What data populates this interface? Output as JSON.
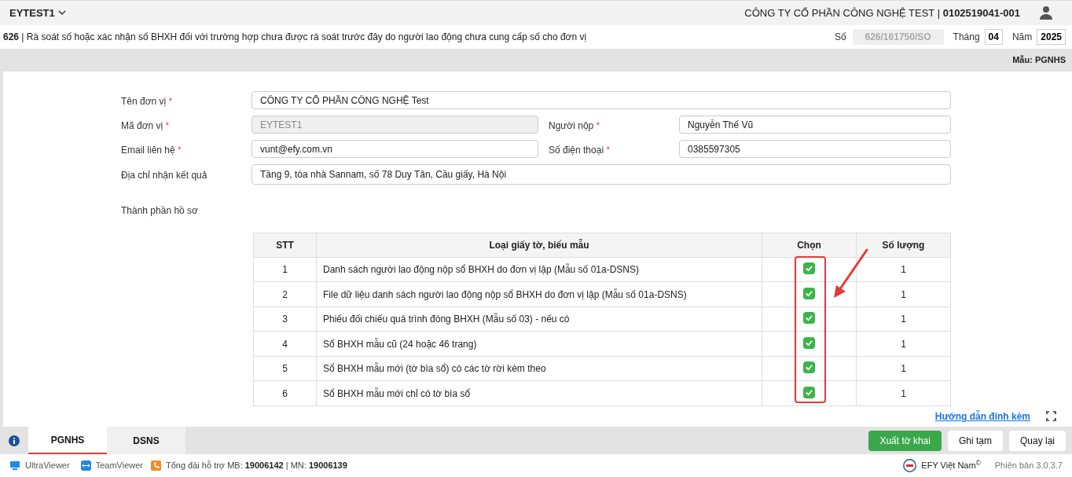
{
  "top_bar": {
    "unit_code": "EYTEST1",
    "company": "CÔNG TY CỔ PHẦN CÔNG NGHỆ TEST | ",
    "tax_code": "0102519041-001"
  },
  "title_bar": {
    "code": "626",
    "title": " | Rà soát số hoặc xác nhận số BHXH đối với trường hợp chưa được rà soát trước đây do người lao động chưa cung cấp số cho đơn vị",
    "number_label": "Số",
    "number_value": "626/161750/SO",
    "month_label": "Tháng",
    "month_value": "04",
    "year_label": "Năm",
    "year_value": "2025"
  },
  "template_label": "Mẫu: PGNHS",
  "form": {
    "unit_name": {
      "label": "Tên đơn vị",
      "value": "CÔNG TY CỔ PHẦN CÔNG NGHỆ Test"
    },
    "unit_code": {
      "label": "Mã đơn vị",
      "value": "EYTEST1",
      "disabled": true
    },
    "submitter": {
      "label": "Người nộp",
      "value": "Nguyễn Thế Vũ"
    },
    "email": {
      "label": "Email liên hệ",
      "value": "vunt@efy.com.vn"
    },
    "phone": {
      "label": "Số điện thoại",
      "value": "0385597305"
    },
    "address": {
      "label": "Địa chỉ nhận kết quả",
      "value": "Tầng 9, tòa nhà Sannam, số 78 Duy Tân, Cầu giấy, Hà Nội"
    },
    "required_mark": "*"
  },
  "section_label": "Thành phần hồ sơ",
  "table": {
    "columns": [
      "STT",
      "Loại giấy tờ, biểu mẫu",
      "Chọn",
      "Số lượng"
    ],
    "rows": [
      {
        "stt": "1",
        "name": "Danh sách người lao động nộp sổ BHXH do đơn vị lập (Mẫu số 01a-DSNS)",
        "checked": true,
        "quantity": "1"
      },
      {
        "stt": "2",
        "name": "File dữ liệu danh sách người lao động nộp sổ BHXH do đơn vị lập (Mẫu số 01a-DSNS)",
        "checked": true,
        "quantity": "1"
      },
      {
        "stt": "3",
        "name": "Phiếu đối chiếu quá trình đóng BHXH (Mẫu số 03) - nếu có",
        "checked": true,
        "quantity": "1"
      },
      {
        "stt": "4",
        "name": "Sổ BHXH mẫu cũ (24 hoặc 46 trang)",
        "checked": true,
        "quantity": "1"
      },
      {
        "stt": "5",
        "name": "Sổ BHXH mẫu mới (tờ bìa sổ) có các tờ rời kèm theo",
        "checked": true,
        "quantity": "1"
      },
      {
        "stt": "6",
        "name": "Sổ BHXH mẫu mới chỉ có tờ bìa sổ",
        "checked": true,
        "quantity": "1"
      }
    ]
  },
  "guide_link": "Hướng dẫn đính kèm",
  "tabs": [
    {
      "label": "PGNHS",
      "selected": true
    },
    {
      "label": "DSNS",
      "selected": false
    }
  ],
  "buttons": [
    {
      "label": "Xuất tờ khai",
      "kind": "primary"
    },
    {
      "label": "Ghi tạm",
      "kind": "secondary"
    },
    {
      "label": "Quay lại",
      "kind": "secondary"
    }
  ],
  "footer": {
    "ultraviewer": "UltraViewer",
    "teamviewer": "TeamViewer",
    "hotline_prefix": "Tổng đài hỗ trợ MB: ",
    "hotline_mb": "19006142",
    "hotline_sep": " | MN: ",
    "hotline_mn": "19006139",
    "brand": "EFY Việt Nam",
    "copyright": "©",
    "version": "Phiên bản 3.0.3.7"
  }
}
